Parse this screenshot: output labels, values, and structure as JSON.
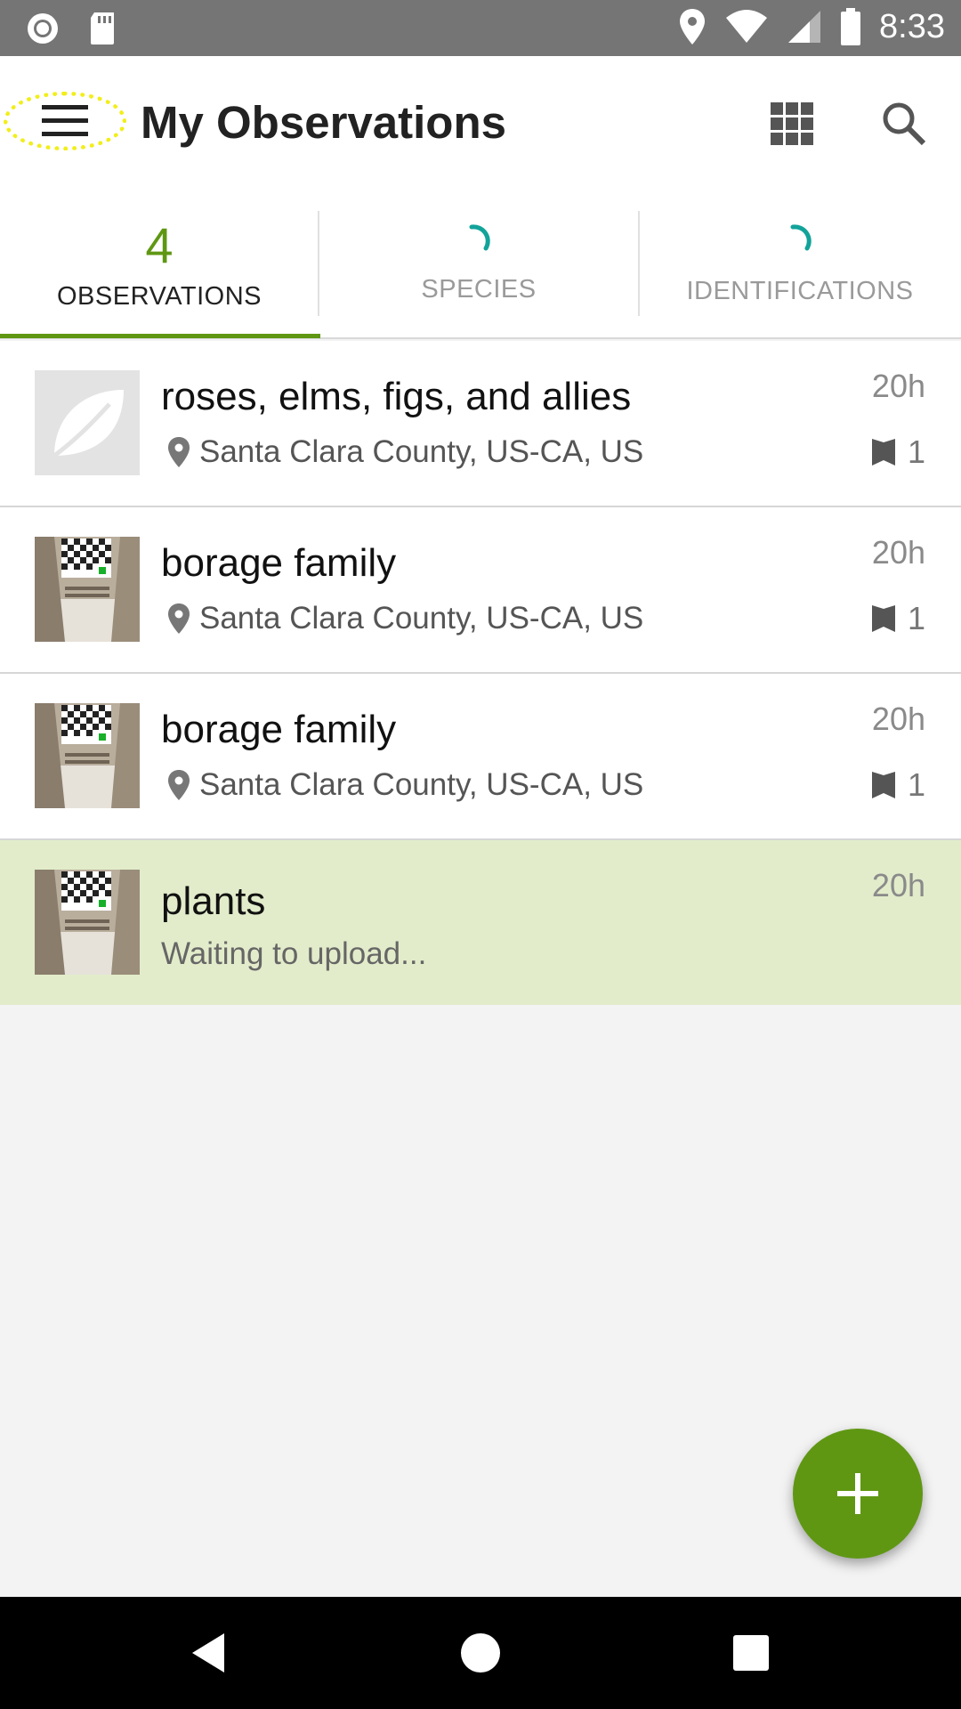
{
  "status_bar": {
    "time": "8:33",
    "left_icons": [
      "record-icon",
      "sd-card-icon"
    ],
    "right_icons": [
      "location-icon",
      "wifi-icon",
      "signal-icon",
      "battery-icon"
    ]
  },
  "app_bar": {
    "title": "My Observations",
    "menu_icon": "hamburger-menu-icon",
    "grid_icon": "grid-view-icon",
    "search_icon": "search-icon"
  },
  "tabs": [
    {
      "count": "4",
      "label": "OBSERVATIONS",
      "active": true
    },
    {
      "count": "",
      "label": "SPECIES",
      "active": false,
      "loading": true
    },
    {
      "count": "",
      "label": "IDENTIFICATIONS",
      "active": false,
      "loading": true
    }
  ],
  "observations": [
    {
      "name": "roses, elms, figs, and allies",
      "location": "Santa Clara County, US-CA, US",
      "time": "20h",
      "id_count": "1",
      "thumb": "leaf-placeholder"
    },
    {
      "name": "borage family",
      "location": "Santa Clara County, US-CA, US",
      "time": "20h",
      "id_count": "1",
      "thumb": "photo"
    },
    {
      "name": "borage family",
      "location": "Santa Clara County, US-CA, US",
      "time": "20h",
      "id_count": "1",
      "thumb": "photo"
    },
    {
      "name": "plants",
      "status": "Waiting to upload...",
      "time": "20h",
      "thumb": "photo",
      "pending": true
    }
  ],
  "colors": {
    "accent": "#5f9713",
    "pending_row": "#e2ecca",
    "spinner": "#12a39a",
    "status_bar": "#757575"
  },
  "fab": {
    "icon": "plus-icon"
  },
  "nav_bar": {
    "icons": [
      "back-icon",
      "home-icon",
      "recents-icon"
    ]
  }
}
